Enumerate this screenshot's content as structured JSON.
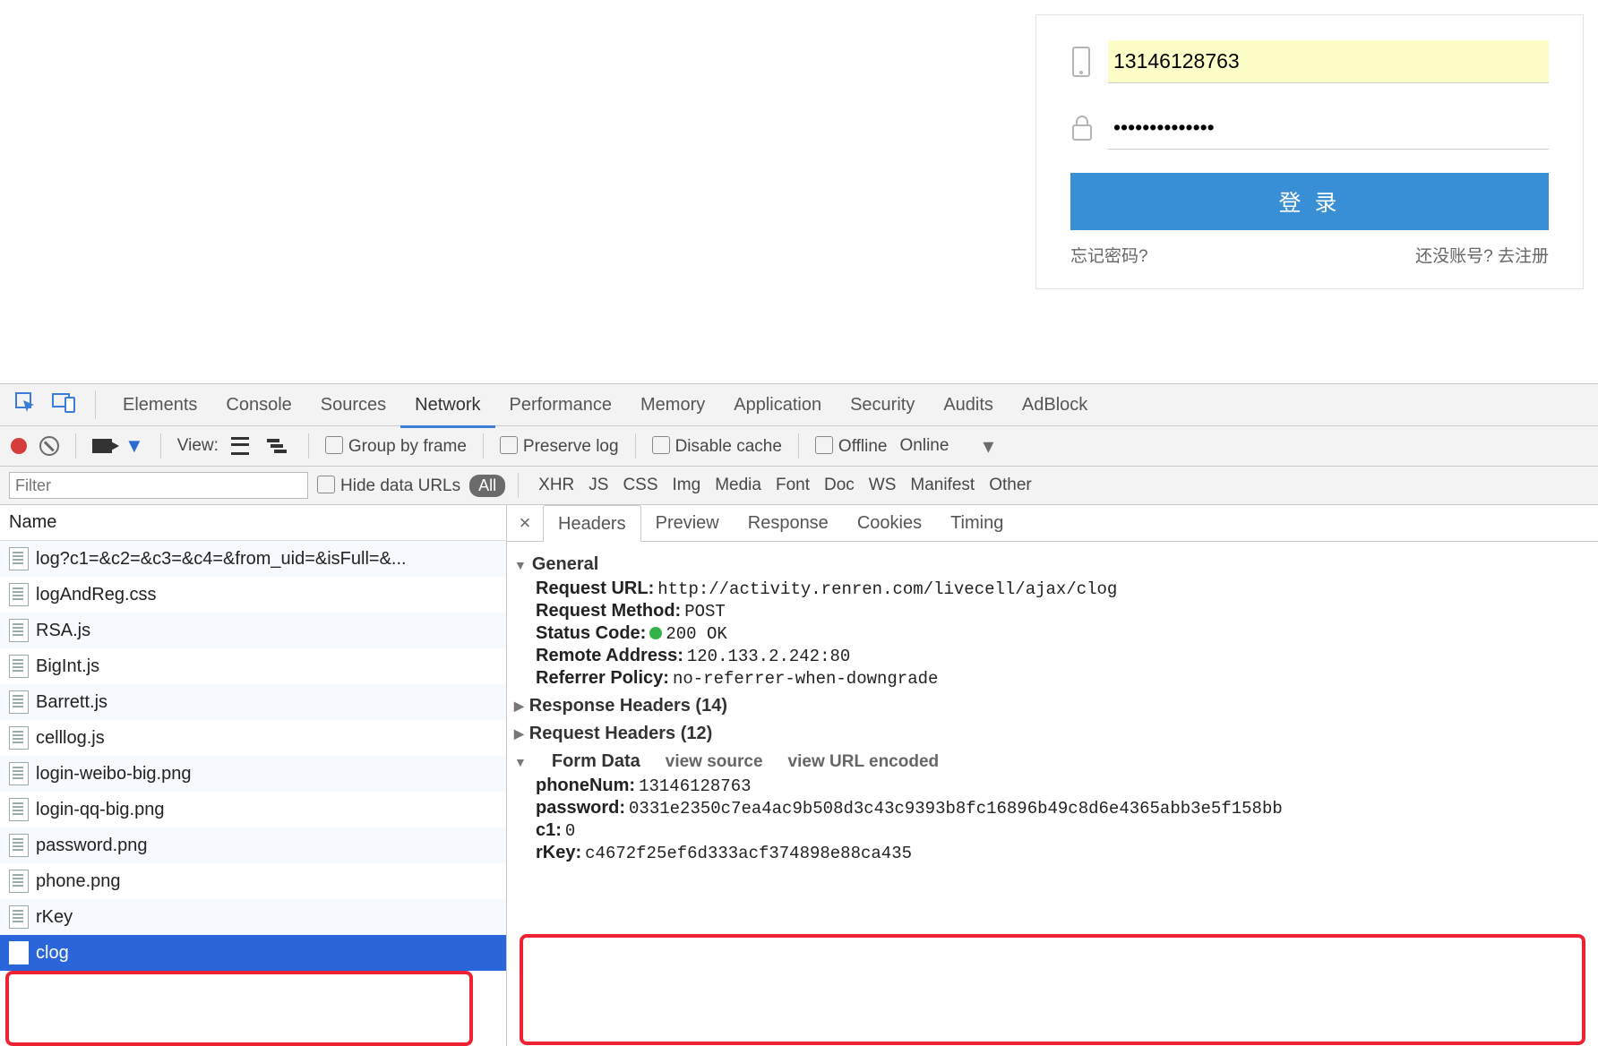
{
  "login": {
    "phone_value": "13146128763",
    "password_mask": "●●●●●●●●●●●●●●",
    "button": "登 录",
    "forgot": "忘记密码?",
    "noacct": "还没账号? 去注册"
  },
  "devtools_tabs": [
    "Elements",
    "Console",
    "Sources",
    "Network",
    "Performance",
    "Memory",
    "Application",
    "Security",
    "Audits",
    "AdBlock"
  ],
  "devtools_active": "Network",
  "toolbar2": {
    "view_label": "View:",
    "group": "Group by frame",
    "preserve": "Preserve log",
    "disable_cache": "Disable cache",
    "offline": "Offline",
    "online": "Online"
  },
  "toolbar3": {
    "filter_placeholder": "Filter",
    "hide_data": "Hide data URLs",
    "all": "All",
    "types": [
      "XHR",
      "JS",
      "CSS",
      "Img",
      "Media",
      "Font",
      "Doc",
      "WS",
      "Manifest",
      "Other"
    ]
  },
  "left_header": "Name",
  "requests": [
    "log?c1=&c2=&c3=&c4=&from_uid=&isFull=&...",
    "logAndReg.css",
    "RSA.js",
    "BigInt.js",
    "Barrett.js",
    "celllog.js",
    "login-weibo-big.png",
    "login-qq-big.png",
    "password.png",
    "phone.png",
    "rKey",
    "clog"
  ],
  "requests_selected": "clog",
  "detail_tabs": [
    "Headers",
    "Preview",
    "Response",
    "Cookies",
    "Timing"
  ],
  "detail_active": "Headers",
  "general": {
    "title": "General",
    "request_url_k": "Request URL:",
    "request_url_v": "http://activity.renren.com/livecell/ajax/clog",
    "request_method_k": "Request Method:",
    "request_method_v": "POST",
    "status_code_k": "Status Code:",
    "status_code_v": "200 OK",
    "remote_k": "Remote Address:",
    "remote_v": "120.133.2.242:80",
    "referrer_k": "Referrer Policy:",
    "referrer_v": "no-referrer-when-downgrade"
  },
  "resp_headers": "Response Headers (14)",
  "req_headers": "Request Headers (12)",
  "form_data": {
    "title": "Form Data",
    "view_source": "view source",
    "view_url": "view URL encoded",
    "items": [
      {
        "k": "phoneNum:",
        "v": "13146128763"
      },
      {
        "k": "password:",
        "v": "0331e2350c7ea4ac9b508d3c43c9393b8fc16896b49c8d6e4365abb3e5f158bb"
      },
      {
        "k": "c1:",
        "v": "0"
      },
      {
        "k": "rKey:",
        "v": "c4672f25ef6d333acf374898e88ca435"
      }
    ]
  }
}
